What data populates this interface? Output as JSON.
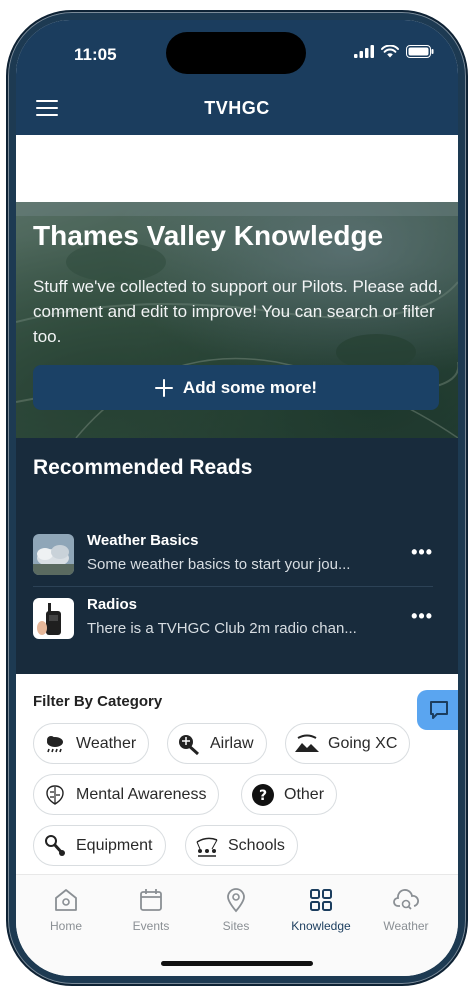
{
  "status": {
    "time": "11:05"
  },
  "header": {
    "title": "TVHGC"
  },
  "hero": {
    "title": "Thames Valley Knowledge",
    "description": "Stuff we've collected to support our Pilots. Please add, comment and edit to improve! You can search or filter too.",
    "add_button": "Add some more!"
  },
  "recommended": {
    "title": "Recommended Reads",
    "items": [
      {
        "title": "Weather Basics",
        "subtitle": "Some weather basics to start your jou...",
        "more": "•••",
        "icon": "weather-thumbnail"
      },
      {
        "title": "Radios",
        "subtitle": "There is a TVHGC Club 2m radio chan...",
        "more": "•••",
        "icon": "radio-thumbnail"
      }
    ]
  },
  "filter": {
    "title": "Filter By Category",
    "chips": [
      {
        "label": "Weather",
        "icon": "weather-icon"
      },
      {
        "label": "Airlaw",
        "icon": "airlaw-icon"
      },
      {
        "label": "Going XC",
        "icon": "going-xc-icon"
      },
      {
        "label": "Mental Awareness",
        "icon": "brain-icon"
      },
      {
        "label": "Other",
        "icon": "question-icon"
      },
      {
        "label": "Equipment",
        "icon": "equipment-icon"
      },
      {
        "label": "Schools",
        "icon": "schools-icon"
      }
    ]
  },
  "nav": [
    {
      "label": "Home",
      "icon": "home-icon"
    },
    {
      "label": "Events",
      "icon": "calendar-icon"
    },
    {
      "label": "Sites",
      "icon": "location-pin-icon"
    },
    {
      "label": "Knowledge",
      "icon": "grid-icon",
      "active": true
    },
    {
      "label": "Weather",
      "icon": "cloud-search-icon"
    }
  ],
  "colors": {
    "header": "#1b3d5e",
    "reads_bg": "#182b3c",
    "button": "#1b4166",
    "fab": "#5aa5f0"
  }
}
